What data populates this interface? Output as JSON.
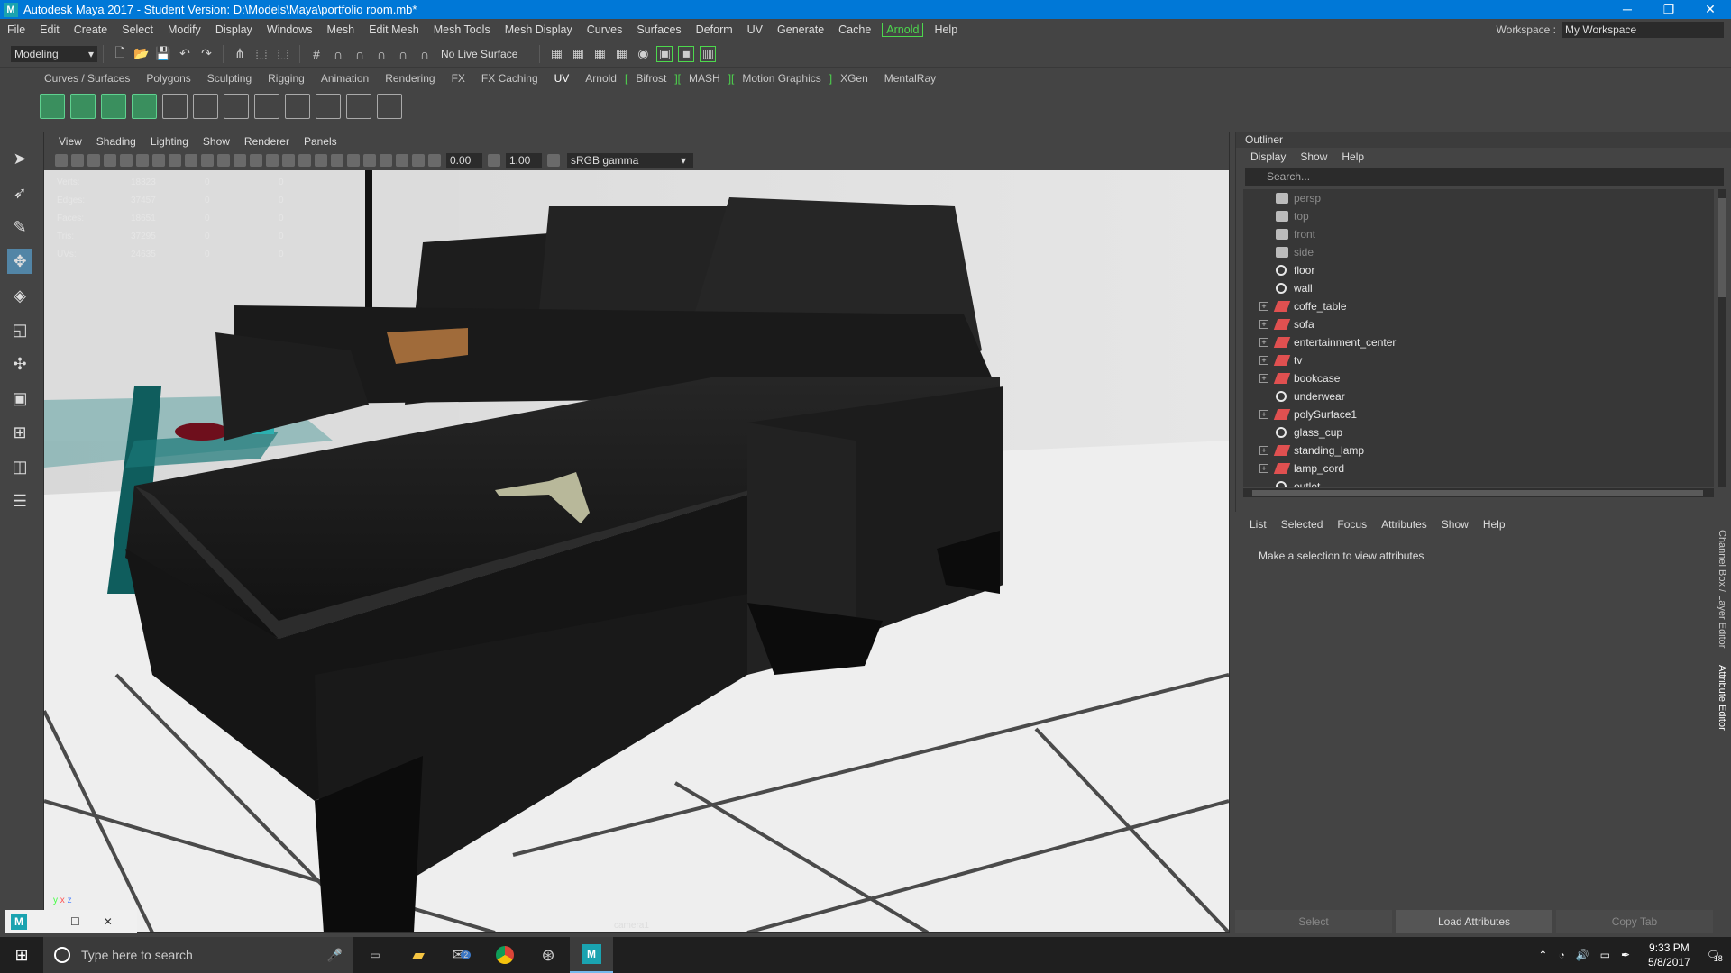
{
  "window": {
    "title": "Autodesk Maya 2017 - Student Version: D:\\Models\\Maya\\portfolio room.mb*",
    "minimize": "─",
    "maximize": "❐",
    "close": "✕"
  },
  "menubar": {
    "items": [
      "File",
      "Edit",
      "Create",
      "Select",
      "Modify",
      "Display",
      "Windows",
      "Mesh",
      "Edit Mesh",
      "Mesh Tools",
      "Mesh Display",
      "Curves",
      "Surfaces",
      "Deform",
      "UV",
      "Generate",
      "Cache"
    ],
    "arnold": "Arnold",
    "help": "Help",
    "workspace_label": "Workspace :",
    "workspace_value": "My Workspace"
  },
  "statusline": {
    "mode": "Modeling",
    "live_surface": "No Live Surface"
  },
  "shelf": {
    "tabs": [
      "Curves / Surfaces",
      "Polygons",
      "Sculpting",
      "Rigging",
      "Animation",
      "Rendering",
      "FX",
      "FX Caching",
      "UV",
      "Arnold",
      "Bifrost",
      "MASH",
      "Motion Graphics",
      "XGen",
      "MentalRay"
    ],
    "active_tab": "UV"
  },
  "viewport": {
    "menu": [
      "View",
      "Shading",
      "Lighting",
      "Show",
      "Renderer",
      "Panels"
    ],
    "exposure": "0.00",
    "gamma_value": "1.00",
    "color_space": "sRGB gamma",
    "camera_label": "camera1",
    "hud": [
      {
        "label": "Verts:",
        "a": "18323",
        "b": "0",
        "c": "0"
      },
      {
        "label": "Edges:",
        "a": "37457",
        "b": "0",
        "c": "0"
      },
      {
        "label": "Faces:",
        "a": "18651",
        "b": "0",
        "c": "0"
      },
      {
        "label": "Tris:",
        "a": "37295",
        "b": "0",
        "c": "0"
      },
      {
        "label": "UVs:",
        "a": "24635",
        "b": "0",
        "c": "0"
      }
    ]
  },
  "outliner": {
    "title": "Outliner",
    "menu": [
      "Display",
      "Show",
      "Help"
    ],
    "search_placeholder": "Search...",
    "items": [
      {
        "name": "persp",
        "type": "camera",
        "expandable": false,
        "dim": true
      },
      {
        "name": "top",
        "type": "camera",
        "expandable": false,
        "dim": true
      },
      {
        "name": "front",
        "type": "camera",
        "expandable": false,
        "dim": true
      },
      {
        "name": "side",
        "type": "camera",
        "expandable": false,
        "dim": true
      },
      {
        "name": "floor",
        "type": "mesh",
        "expandable": false,
        "dim": false
      },
      {
        "name": "wall",
        "type": "mesh",
        "expandable": false,
        "dim": false
      },
      {
        "name": "coffe_table",
        "type": "group",
        "expandable": true,
        "dim": false
      },
      {
        "name": "sofa",
        "type": "group",
        "expandable": true,
        "dim": false
      },
      {
        "name": "entertainment_center",
        "type": "group",
        "expandable": true,
        "dim": false
      },
      {
        "name": "tv",
        "type": "group",
        "expandable": true,
        "dim": false
      },
      {
        "name": "bookcase",
        "type": "group",
        "expandable": true,
        "dim": false
      },
      {
        "name": "underwear",
        "type": "mesh",
        "expandable": false,
        "dim": false
      },
      {
        "name": "polySurface1",
        "type": "group",
        "expandable": true,
        "dim": false
      },
      {
        "name": "glass_cup",
        "type": "mesh",
        "expandable": false,
        "dim": false
      },
      {
        "name": "standing_lamp",
        "type": "group",
        "expandable": true,
        "dim": false
      },
      {
        "name": "lamp_cord",
        "type": "group",
        "expandable": true,
        "dim": false
      },
      {
        "name": "outlet",
        "type": "mesh",
        "expandable": false,
        "dim": false
      }
    ]
  },
  "attribute_editor": {
    "menu": [
      "List",
      "Selected",
      "Focus",
      "Attributes",
      "Show",
      "Help"
    ],
    "message": "Make a selection to view attributes",
    "buttons": {
      "select": "Select",
      "load": "Load Attributes",
      "copy": "Copy Tab"
    },
    "side_tabs": [
      "Channel Box / Layer Editor",
      "Attribute Editor"
    ]
  },
  "taskbar": {
    "search_placeholder": "Type here to search",
    "time": "9:33 PM",
    "date": "5/8/2017",
    "notifications": "18",
    "mail_badge": "2"
  },
  "axis": {
    "x": "x",
    "y": "y",
    "z": "z"
  }
}
